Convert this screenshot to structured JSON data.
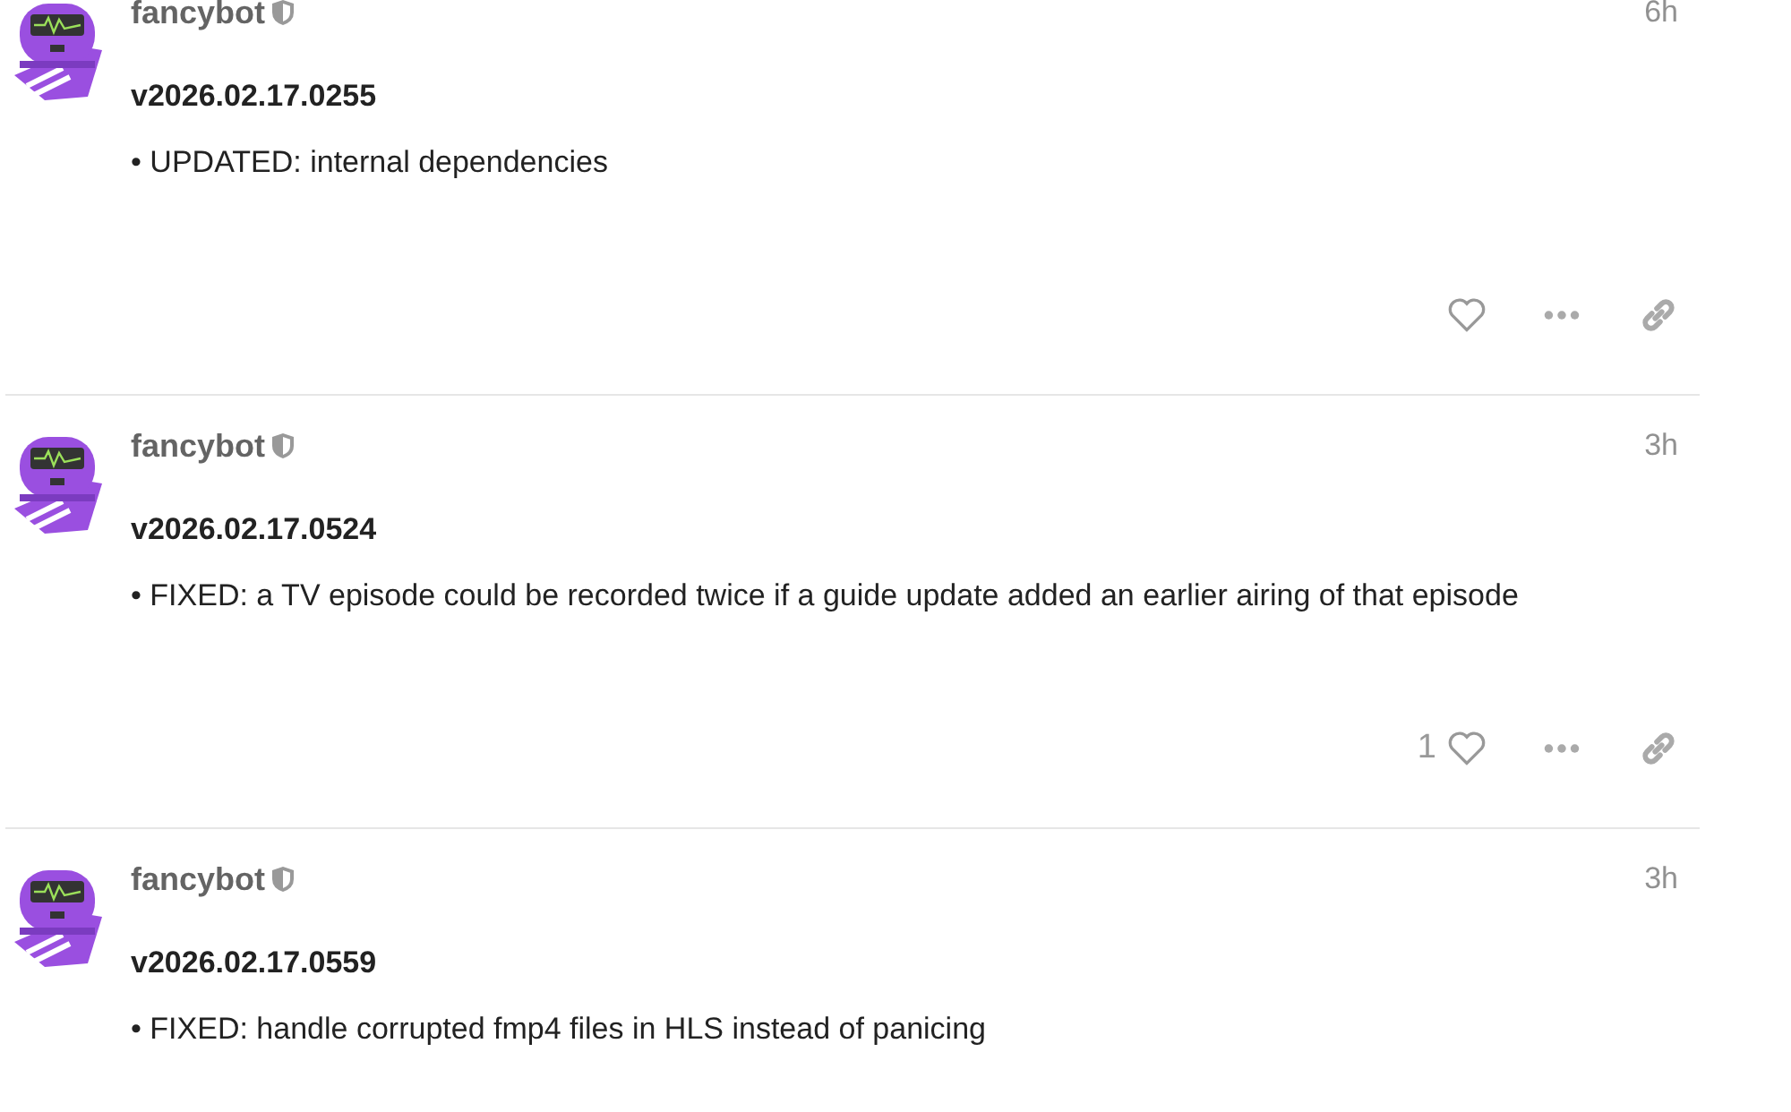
{
  "posts": [
    {
      "author": "fancybot",
      "moderator": true,
      "time": "6h",
      "title": "v2026.02.17.0255",
      "body": "• UPDATED: internal dependencies",
      "liked": false
    },
    {
      "author": "fancybot",
      "moderator": true,
      "time": "3h",
      "title": "v2026.02.17.0524",
      "body": "• FIXED: a TV episode could be recorded twice if a guide update added an earlier airing of that episode",
      "likes": "1",
      "liked": false
    },
    {
      "author": "fancybot",
      "moderator": true,
      "time": "3h",
      "title": "v2026.02.17.0559",
      "body": "• FIXED: handle corrupted fmp4 files in HLS instead of panicing"
    }
  ]
}
